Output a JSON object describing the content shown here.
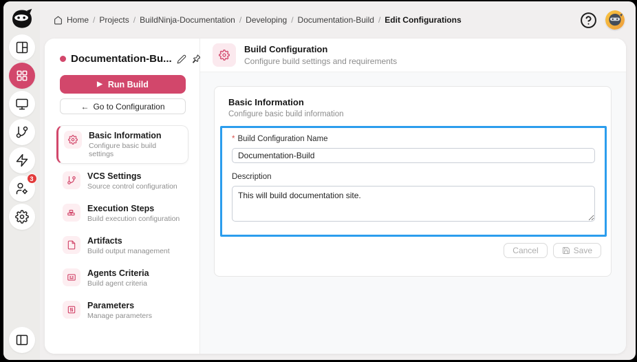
{
  "colors": {
    "accent": "#d2476b",
    "focus_highlight": "#2b9ded",
    "badge": "#e23b3b"
  },
  "topbar": {
    "separator": "/",
    "breadcrumb": [
      "Home",
      "Projects",
      "BuildNinja-Documentation",
      "Developing",
      "Documentation-Build",
      "Edit Configurations"
    ]
  },
  "rail": {
    "badge_count": "3"
  },
  "icons": {
    "play": "▶",
    "back_arrow": "←"
  },
  "sidebar": {
    "project_title": "Documentation-Bu...",
    "run_build_label": "Run Build",
    "goto_config_label": "Go to Configuration",
    "items": [
      {
        "title": "Basic Information",
        "subtitle": "Configure basic build settings"
      },
      {
        "title": "VCS Settings",
        "subtitle": "Source control configuration"
      },
      {
        "title": "Execution Steps",
        "subtitle": "Build execution configuration"
      },
      {
        "title": "Artifacts",
        "subtitle": "Build output management"
      },
      {
        "title": "Agents Criteria",
        "subtitle": "Build agent criteria"
      },
      {
        "title": "Parameters",
        "subtitle": "Manage parameters"
      }
    ]
  },
  "main": {
    "header": {
      "title": "Build Configuration",
      "subtitle": "Configure build settings and requirements"
    },
    "card": {
      "title": "Basic Information",
      "subtitle": "Configure basic build information",
      "required_mark": "*",
      "name_label": "Build Configuration Name",
      "name_value": "Documentation-Build",
      "description_label": "Description",
      "description_value": "This will build documentation site.",
      "cancel_label": "Cancel",
      "save_label": "Save"
    }
  }
}
